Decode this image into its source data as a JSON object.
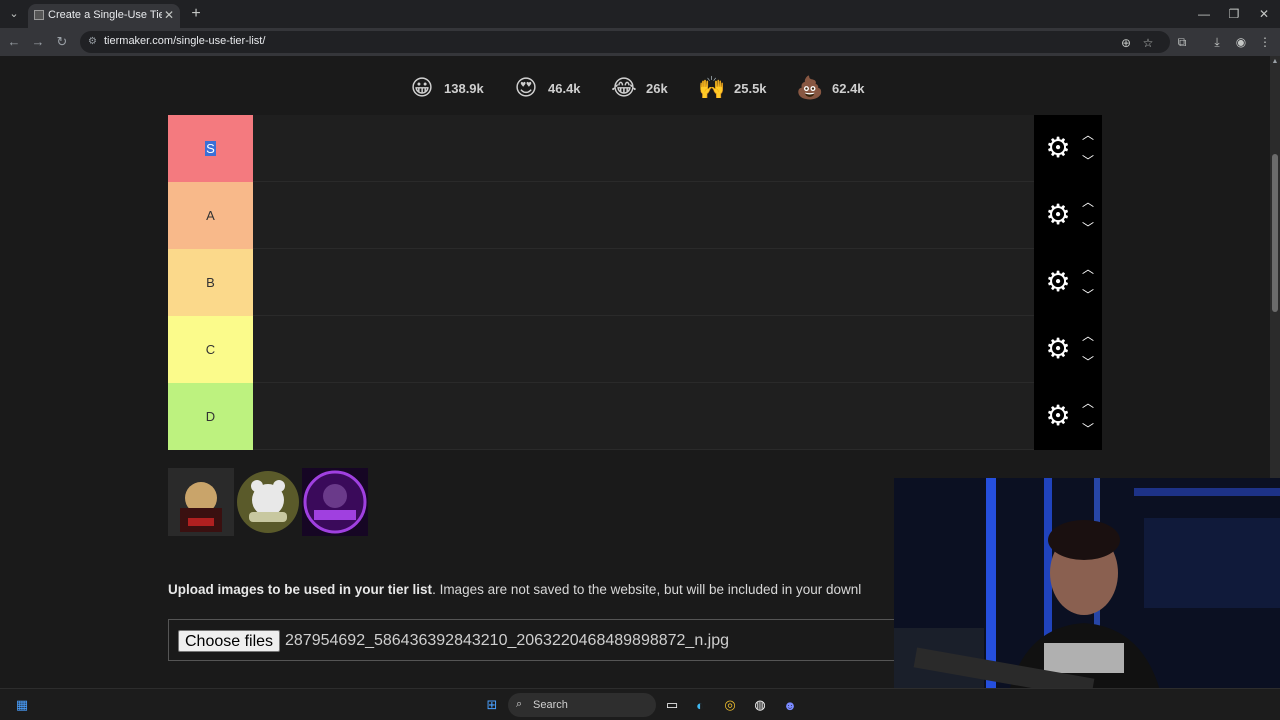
{
  "browser": {
    "tab_title": "Create a Single-Use Tier List (P...",
    "url": "tiermaker.com/single-use-tier-list/"
  },
  "reactions": [
    {
      "icon": "grinning-emoji-icon",
      "glyph": "😀",
      "count": "138.9k"
    },
    {
      "icon": "heart-eyes-emoji-icon",
      "glyph": "😍",
      "count": "46.4k"
    },
    {
      "icon": "laughing-emoji-icon",
      "glyph": "😂",
      "count": "26k"
    },
    {
      "icon": "raised-hands-emoji-icon",
      "glyph": "🙌",
      "count": "25.5k"
    },
    {
      "icon": "poop-emoji-icon",
      "glyph": "💩",
      "count": "62.4k"
    }
  ],
  "tiers": [
    {
      "label": "S",
      "color": "#f47a7f",
      "selected": true
    },
    {
      "label": "A",
      "color": "#f8b98a"
    },
    {
      "label": "B",
      "color": "#fbd98b"
    },
    {
      "label": "C",
      "color": "#fbfb8b"
    },
    {
      "label": "D",
      "color": "#bdf27f"
    }
  ],
  "pool_images": [
    {
      "name": "jmr-avatar-image",
      "colors": [
        "#3a1010",
        "#c9a46a"
      ]
    },
    {
      "name": "bear-avatar-image",
      "colors": [
        "#5a5a2a",
        "#e8e8e8"
      ]
    },
    {
      "name": "purple-gamer-avatar-image",
      "colors": [
        "#3a0a5a",
        "#a040e0"
      ]
    }
  ],
  "upload": {
    "bold": "Upload images to be used in your tier list",
    "rest": ". Images are not saved to the website, but will be included in your downl",
    "button": "Choose files",
    "file_name": "287954692_586436392843210_2063220468489898872_n.jpg"
  },
  "taskbar": {
    "search_label": "Search"
  }
}
